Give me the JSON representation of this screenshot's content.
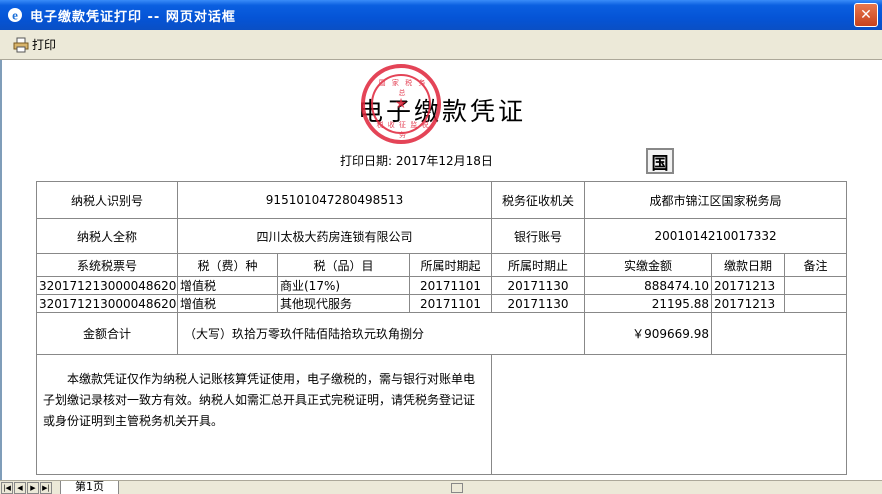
{
  "window": {
    "title": "电子缴款凭证打印 -- 网页对话框",
    "close_label": "✕"
  },
  "toolbar": {
    "print_label": "打印"
  },
  "doc": {
    "title": "电子缴款凭证",
    "print_date": "打印日期:  2017年12月18日",
    "guo_mark": "国",
    "seal_top": "国 家 税 务 总",
    "seal_bottom": "税 收 征 监 税 务"
  },
  "info": {
    "taxpayer_id_label": "纳税人识别号",
    "taxpayer_id": "915101047280498513",
    "tax_office_label": "税务征收机关",
    "tax_office": "成都市锦江区国家税务局",
    "taxpayer_name_label": "纳税人全称",
    "taxpayer_name": "四川太极大药房连锁有限公司",
    "bank_account_label": "银行账号",
    "bank_account": "2001014210017332"
  },
  "columns": [
    "系统税票号",
    "税（费）种",
    "税（品）目",
    "所属时期起",
    "所属时期止",
    "实缴金额",
    "缴款日期",
    "备注"
  ],
  "rows": [
    {
      "ticket": "320171213000048620",
      "type": "增值税",
      "item": "商业(17%)",
      "start": "20171101",
      "end": "20171130",
      "amount": "888474.10",
      "date": "20171213",
      "note": ""
    },
    {
      "ticket": "320171213000048620",
      "type": "增值税",
      "item": "其他现代服务",
      "start": "20171101",
      "end": "20171130",
      "amount": "21195.88",
      "date": "20171213",
      "note": ""
    }
  ],
  "total": {
    "label": "金额合计",
    "uppercase": "（大写）玖拾万零玖仟陆佰陆拾玖元玖角捌分",
    "amount": "￥909669.98"
  },
  "notice": "本缴款凭证仅作为纳税人记账核算凭证使用，电子缴税的，需与银行对账单电子划缴记录核对一致方有效。纳税人如需汇总开具正式完税证明，请凭税务登记证或身份证明到主管税务机关开具。",
  "tabs": {
    "page1": "第1页"
  }
}
